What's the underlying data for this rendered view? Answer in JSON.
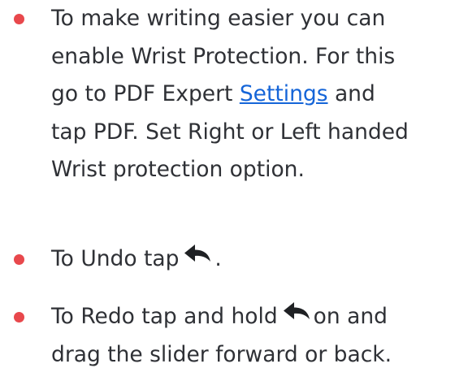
{
  "items": [
    {
      "line1": "To make writing easier you can",
      "line2": "enable Wrist Protection. For this",
      "line3_before": "go to PDF Expert ",
      "line3_link": "Settings",
      "line3_after": " and",
      "line4": "tap PDF. Set Right or Left handed",
      "line5": "Wrist protection option."
    },
    {
      "before": "To Undo tap",
      "after": "."
    },
    {
      "before": "To Redo tap and hold",
      "after": "on and",
      "line2": "drag the slider forward or back."
    }
  ],
  "colors": {
    "bullet": "#e8484c",
    "link": "#1565d8",
    "text": "#2f3136"
  },
  "icons": [
    "undo-icon"
  ]
}
